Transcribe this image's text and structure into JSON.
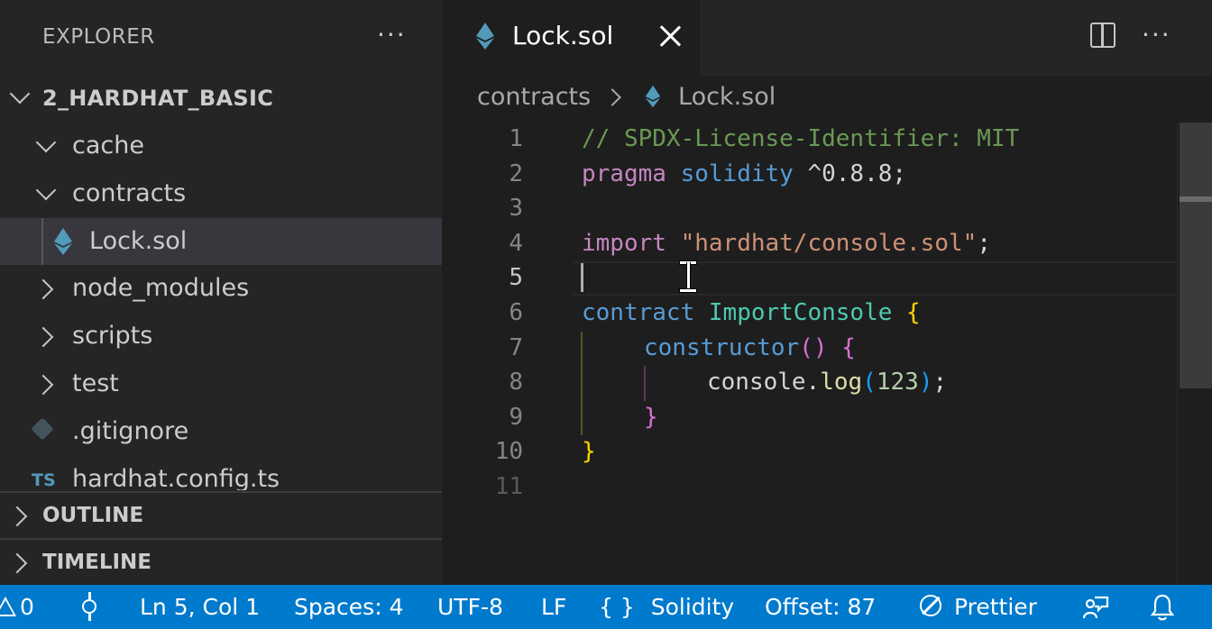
{
  "sidebar": {
    "title": "EXPLORER",
    "more_label": "···",
    "root_label": "2_HARDHAT_BASIC",
    "items": [
      {
        "label": "cache"
      },
      {
        "label": "contracts"
      },
      {
        "label": "Lock.sol"
      },
      {
        "label": "node_modules"
      },
      {
        "label": "scripts"
      },
      {
        "label": "test"
      },
      {
        "label": ".gitignore"
      },
      {
        "label": "hardhat.config.ts"
      }
    ],
    "ts_badge": "TS",
    "outline_label": "OUTLINE",
    "timeline_label": "TIMELINE"
  },
  "editor": {
    "tab_label": "Lock.sol",
    "more_label": "···",
    "breadcrumb": [
      "contracts",
      "Lock.sol"
    ],
    "active_line": 5,
    "lines": [
      {
        "n": "1"
      },
      {
        "n": "2"
      },
      {
        "n": "3"
      },
      {
        "n": "4"
      },
      {
        "n": "5"
      },
      {
        "n": "6"
      },
      {
        "n": "7"
      },
      {
        "n": "8"
      },
      {
        "n": "9"
      },
      {
        "n": "10"
      },
      {
        "n": "11"
      }
    ],
    "code": {
      "l1": "// SPDX-License-Identifier: MIT",
      "l2_kw": "pragma",
      "l2_name": "solidity",
      "l2_ver": " ^0.8.8;",
      "l4_kw": "import",
      "l4_str": "\"hardhat/console.sol\"",
      "l4_end": ";",
      "l6_kw": "contract",
      "l6_name": "ImportConsole",
      "l6_brace": "{",
      "l7_kw": "constructor",
      "l7_paren": "()",
      "l7_brace": "{",
      "l8_obj": "console",
      "l8_dot": ".",
      "l8_fn": "log",
      "l8_open": "(",
      "l8_num": "123",
      "l8_close": ")",
      "l8_end": ";",
      "l9_brace": "}",
      "l10_brace": "}"
    }
  },
  "status": {
    "problems_count": "0",
    "position": "Ln 5, Col 1",
    "spaces": "Spaces: 4",
    "encoding": "UTF-8",
    "eol": "LF",
    "braces_glyph": "{ }",
    "language": "Solidity",
    "offset": "Offset: 87",
    "prettier": "Prettier"
  },
  "colors": {
    "accent": "#007acc",
    "comment": "#6a9955",
    "keyword": "#c586c0",
    "storage": "#569cd6",
    "string": "#ce9178",
    "type": "#4ec9b0",
    "function": "#dcdcaa",
    "number": "#b5cea8",
    "ethereum_icon": "#519aba"
  },
  "icons": {
    "file_icon": "ethereum-icon",
    "gitignore_icon": "git-icon",
    "split": "split-editor-icon",
    "close": "close-icon"
  }
}
